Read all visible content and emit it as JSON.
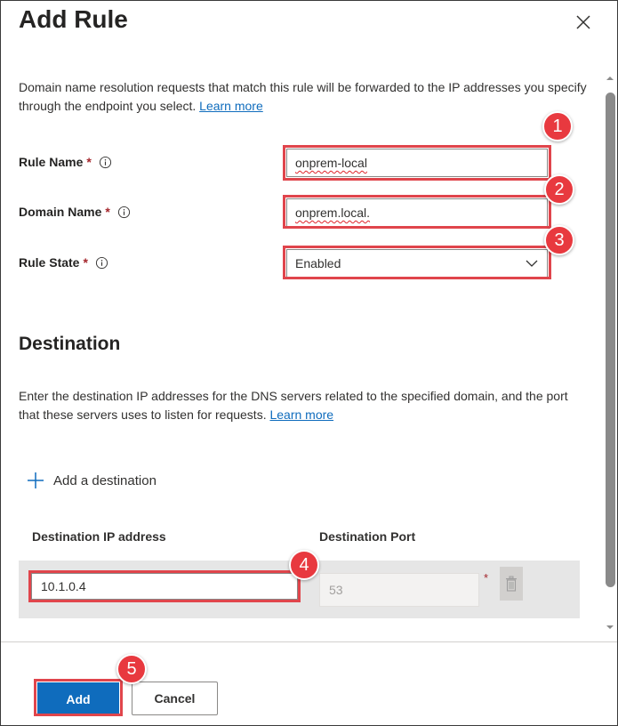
{
  "dialog": {
    "title": "Add Rule",
    "description": "Domain name resolution requests that match this rule will be forwarded to the IP addresses you specify through the endpoint you select.",
    "learn_more": "Learn more"
  },
  "form": {
    "rule_name": {
      "label": "Rule Name",
      "required": "*",
      "value": "onprem-local"
    },
    "domain_name": {
      "label": "Domain Name",
      "required": "*",
      "value": "onprem.local."
    },
    "rule_state": {
      "label": "Rule State",
      "required": "*",
      "value": "Enabled"
    }
  },
  "destination": {
    "heading": "Destination",
    "description": "Enter the destination IP addresses for the DNS servers related to the specified domain, and the port that these servers uses to listen for requests.",
    "learn_more": "Learn more",
    "add_label": "Add a destination",
    "columns": [
      "Destination IP address",
      "Destination Port"
    ],
    "row": {
      "ip": "10.1.0.4",
      "port": "53",
      "port_required": "*"
    }
  },
  "footer": {
    "add_label": "Add",
    "cancel_label": "Cancel"
  },
  "callouts": [
    "1",
    "2",
    "3",
    "4",
    "5"
  ],
  "icons": {
    "close": "close-icon",
    "info": "info-icon",
    "plus": "plus-icon",
    "chevron": "chevron-down-icon",
    "trash": "trash-icon"
  },
  "colors": {
    "accent": "#0f6cbd",
    "callout": "#e8393f",
    "required": "#a4262c"
  }
}
